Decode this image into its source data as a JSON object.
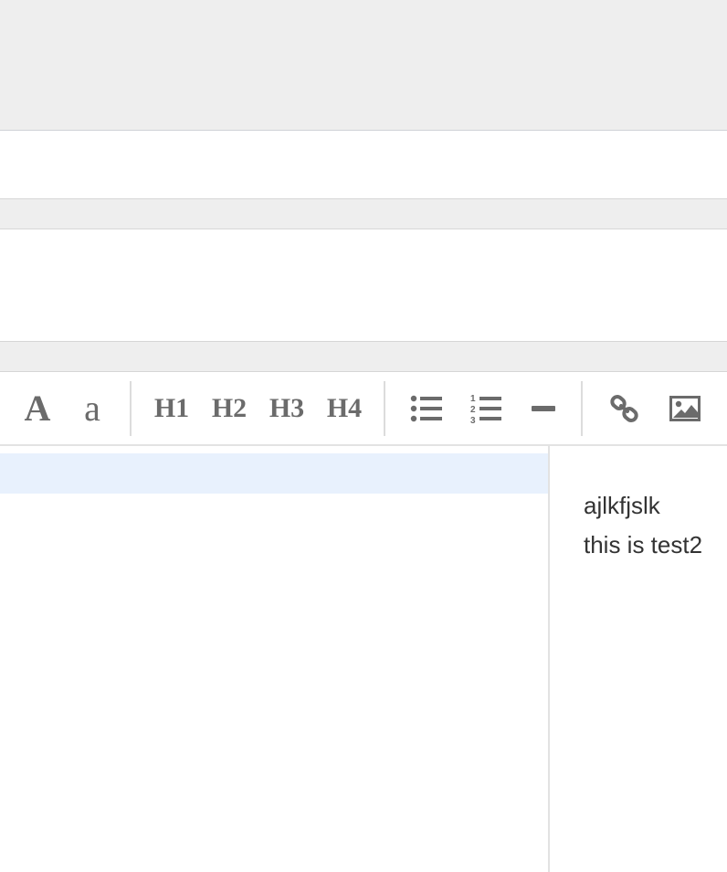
{
  "toolbar": {
    "bold_label": "A",
    "italic_label": "a",
    "headings": [
      "H1",
      "H2",
      "H3",
      "H4"
    ]
  },
  "icons": {
    "bold": "bold-icon",
    "italic": "italic-icon",
    "unordered_list": "bullet-list-icon",
    "ordered_list": "numbered-list-icon",
    "horizontal_rule": "horizontal-rule-icon",
    "link": "link-icon",
    "image": "image-icon"
  },
  "preview": {
    "lines": [
      "ajlkfjslk",
      "this is test2"
    ]
  },
  "colors": {
    "toolbar_icon": "#6b6b6b",
    "active_line": "#e8f1fd",
    "gray_band": "#eeeeee",
    "preview_text": "#333333"
  }
}
